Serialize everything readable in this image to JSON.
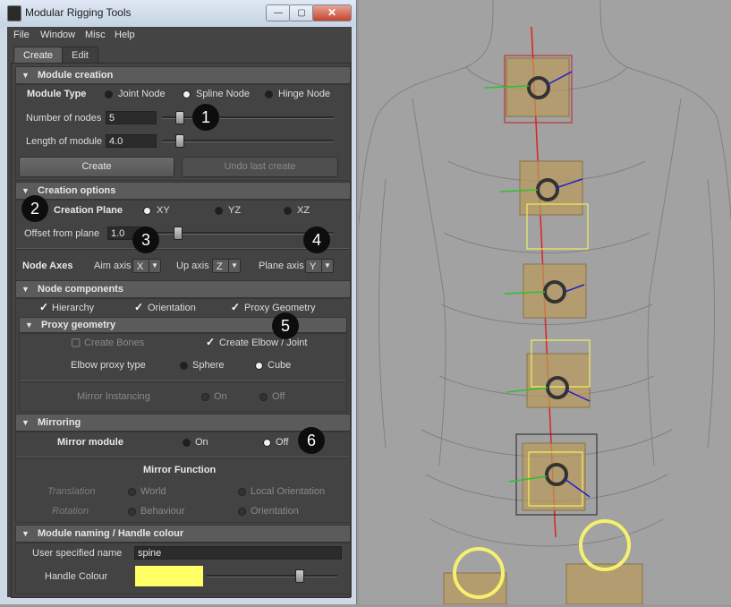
{
  "window": {
    "title": "Modular Rigging Tools",
    "min": "—",
    "max": "▢",
    "close": "✕"
  },
  "menu": [
    "File",
    "Window",
    "Misc",
    "Help"
  ],
  "tabs": {
    "create": "Create",
    "edit": "Edit"
  },
  "module_creation": {
    "title": "Module creation",
    "module_type_label": "Module Type",
    "types": [
      "Joint Node",
      "Spline Node",
      "Hinge Node"
    ],
    "selected_type": "Spline Node",
    "nodes_label": "Number of nodes",
    "nodes_value": "5",
    "length_label": "Length of module",
    "length_value": "4.0",
    "create_button": "Create",
    "undo_button": "Undo last create"
  },
  "creation_options": {
    "title": "Creation options",
    "plane_label": "Creation Plane",
    "planes": [
      "XY",
      "YZ",
      "XZ"
    ],
    "selected_plane": "XY",
    "offset_label": "Offset from plane",
    "offset_value": "1.0",
    "axes_label": "Node Axes",
    "aim_label": "Aim axis",
    "aim_value": "X",
    "up_label": "Up axis",
    "up_value": "Z",
    "plane_axis_label": "Plane axis",
    "plane_axis_value": "Y"
  },
  "node_components": {
    "title": "Node components",
    "hierarchy": "Hierarchy",
    "orientation": "Orientation",
    "proxy_geometry": "Proxy Geometry"
  },
  "proxy_geometry": {
    "title": "Proxy geometry",
    "create_bones": "Create Bones",
    "create_elbow": "Create Elbow / Joint",
    "elbow_type_label": "Elbow proxy type",
    "sphere": "Sphere",
    "cube": "Cube",
    "selected_type": "Cube",
    "mirror_instancing_label": "Mirror Instancing",
    "on": "On",
    "off": "Off"
  },
  "mirroring": {
    "title": "Mirroring",
    "mirror_module_label": "Mirror module",
    "on": "On",
    "off": "Off",
    "selected": "Off",
    "function_title": "Mirror Function",
    "translation_label": "Translation",
    "world": "World",
    "local_orientation": "Local Orientation",
    "rotation_label": "Rotation",
    "behaviour": "Behaviour",
    "orientation": "Orientation"
  },
  "naming": {
    "title": "Module naming / Handle colour",
    "name_label": "User specified name",
    "name_value": "spine",
    "colour_label": "Handle Colour",
    "colour_hex": "#FFFF66"
  },
  "markers": [
    "1",
    "2",
    "3",
    "4",
    "5",
    "6"
  ]
}
